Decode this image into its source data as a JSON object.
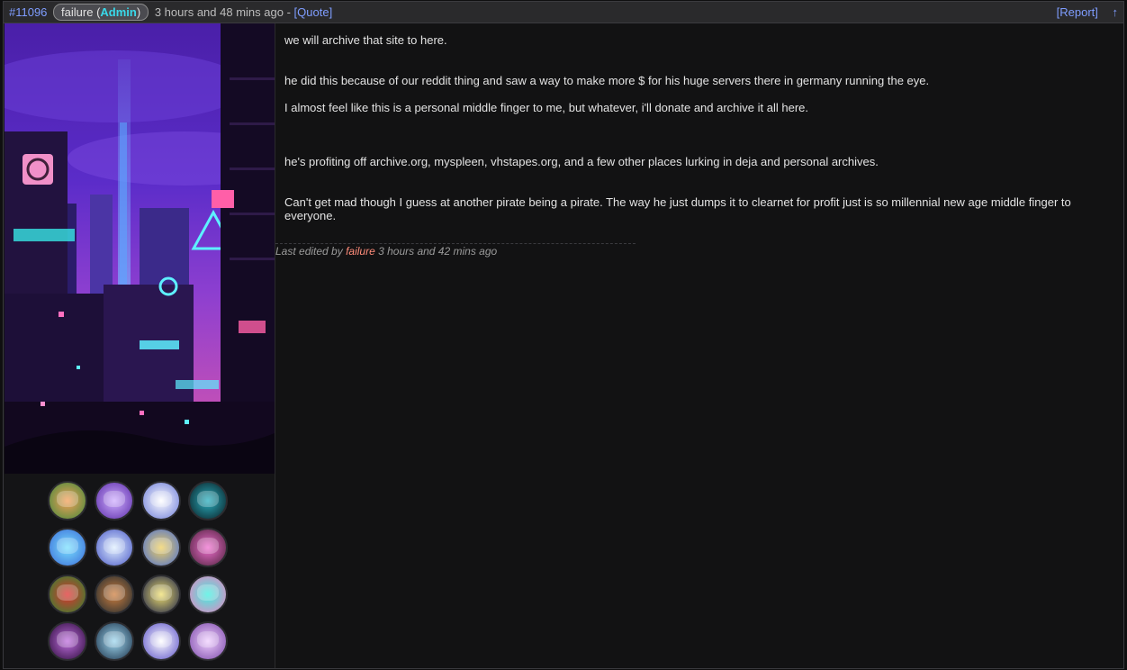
{
  "post": {
    "id": "#11096",
    "user": {
      "name": "failure",
      "role": "Admin"
    },
    "timestamp": "3 hours and 48 mins ago",
    "separator": "-",
    "quote_label": "[Quote]",
    "report_label": "[Report]",
    "up_label": "↑"
  },
  "body": {
    "p1": "we will archive that site to here.",
    "p2": "he did this because of our reddit thing and saw a way to make more $ for his huge servers there in germany running the eye.",
    "p3": "I almost feel like this is a personal middle finger to me, but whatever, i'll donate and archive it all here.",
    "p4": "he's profiting off archive.org, myspleen, vhstapes.org, and a few other places lurking in deja and personal archives.",
    "p5": "Can't get mad though I guess at another pirate being a pirate. The way he just dumps it to clearnet for profit just is so millennial new age middle finger to everyone."
  },
  "edit_note": {
    "prefix": "Last edited by",
    "editor": "failure",
    "time": "3 hours and 42 mins ago"
  },
  "colors": {
    "link": "#7f9dff",
    "role": "#39d9ea",
    "editor": "#ff8c7a",
    "background": "#121213"
  }
}
